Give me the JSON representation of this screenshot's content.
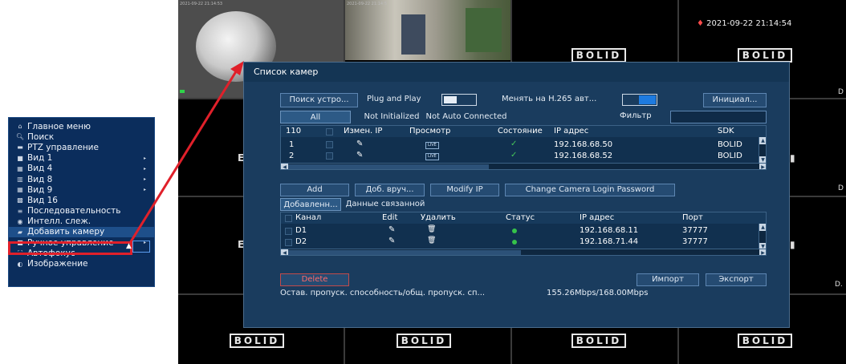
{
  "camera_grid": {
    "timestamp_alarm": "2021-09-22 21:14:54",
    "brand": "BOLID",
    "tile_ts1": "2021-09-22 21:14:53",
    "tile_ts2": "2021-09-22 21:14:5",
    "edge_glyph": "D",
    "edge_glyph2": "D",
    "edge_glyph3": "D.",
    "left_glyph": "E"
  },
  "context_menu": {
    "items": [
      {
        "icon": "home-icon",
        "glyph": "⌂",
        "label": "Главное меню",
        "arrow": false
      },
      {
        "icon": "search-icon",
        "glyph": "🔍︎",
        "label": "Поиск",
        "arrow": false
      },
      {
        "icon": "ptz-icon",
        "glyph": "▬",
        "label": "PTZ управление",
        "arrow": false
      },
      {
        "icon": "view1-icon",
        "glyph": "■",
        "label": "Вид 1",
        "arrow": true
      },
      {
        "icon": "view4-icon",
        "glyph": "▦",
        "label": "Вид 4",
        "arrow": true
      },
      {
        "icon": "view8-icon",
        "glyph": "▥",
        "label": "Вид 8",
        "arrow": true
      },
      {
        "icon": "view9-icon",
        "glyph": "▦",
        "label": "Вид 9",
        "arrow": true
      },
      {
        "icon": "view16-icon",
        "glyph": "▩",
        "label": "Вид 16",
        "arrow": false
      },
      {
        "icon": "sequence-icon",
        "glyph": "≡",
        "label": "Последовательность",
        "arrow": false
      },
      {
        "icon": "intel-icon",
        "glyph": "◉",
        "label": "Интелл. слеж.",
        "arrow": false
      },
      {
        "icon": "add-camera-icon",
        "glyph": "▰",
        "label": "Добавить камеру",
        "arrow": false
      },
      {
        "icon": "manual-icon",
        "glyph": "■",
        "label": "Ручное управление",
        "arrow": true
      },
      {
        "icon": "autofocus-icon",
        "glyph": "⛶",
        "label": "Автофокус",
        "arrow": false
      },
      {
        "icon": "image-icon",
        "glyph": "◐",
        "label": "Изображение",
        "arrow": false
      }
    ],
    "arrow_glyph": "▸"
  },
  "dialog": {
    "title": "Список камер",
    "search_button": "Поиск устро...",
    "plug_and_play_label": "Plug and Play",
    "h265_label": "Менять на H.265 авт...",
    "init_button": "Инициал...",
    "tabs": [
      "All",
      "Not Initialized",
      "Not Auto Connected"
    ],
    "filter_label": "Фильтр",
    "filter_value": "",
    "top_table": {
      "count": "110",
      "headers": [
        "Измен. IP",
        "Просмотр",
        "Состояние",
        "IP адрес",
        "SDK"
      ],
      "rows": [
        {
          "num": "1",
          "live": "LIVE",
          "ip": "192.168.68.50",
          "sdk": "BOLID"
        },
        {
          "num": "2",
          "live": "LIVE",
          "ip": "192.168.68.52",
          "sdk": "BOLID"
        }
      ]
    },
    "add_button": "Add",
    "manual_add_button": "Доб. вруч...",
    "modify_ip_button": "Modify IP",
    "change_pwd_button": "Change Camera Login Password",
    "sub_tabs": [
      "Добавленн...",
      "Данные связанной ..."
    ],
    "bottom_table": {
      "headers": [
        "Канал",
        "Edit",
        "Удалить",
        "Статус",
        "IP адрес",
        "Порт"
      ],
      "rows": [
        {
          "channel": "D1",
          "ip": "192.168.68.11",
          "port": "37777"
        },
        {
          "channel": "D2",
          "ip": "192.168.71.44",
          "port": "37777"
        }
      ]
    },
    "delete_button": "Delete",
    "import_button": "Импорт",
    "export_button": "Экспорт",
    "bandwidth_label": "Остав. пропуск. способность/общ. пропуск. сп...",
    "bandwidth_value": "155.26Mbps/168.00Mbps"
  },
  "colors": {
    "menu_bg": "#0b2d5c",
    "dialog_bg": "#1a3c5e",
    "highlight_red": "#e0202a",
    "toggle_on": "#1e7be0",
    "status_green": "#35c24a"
  }
}
